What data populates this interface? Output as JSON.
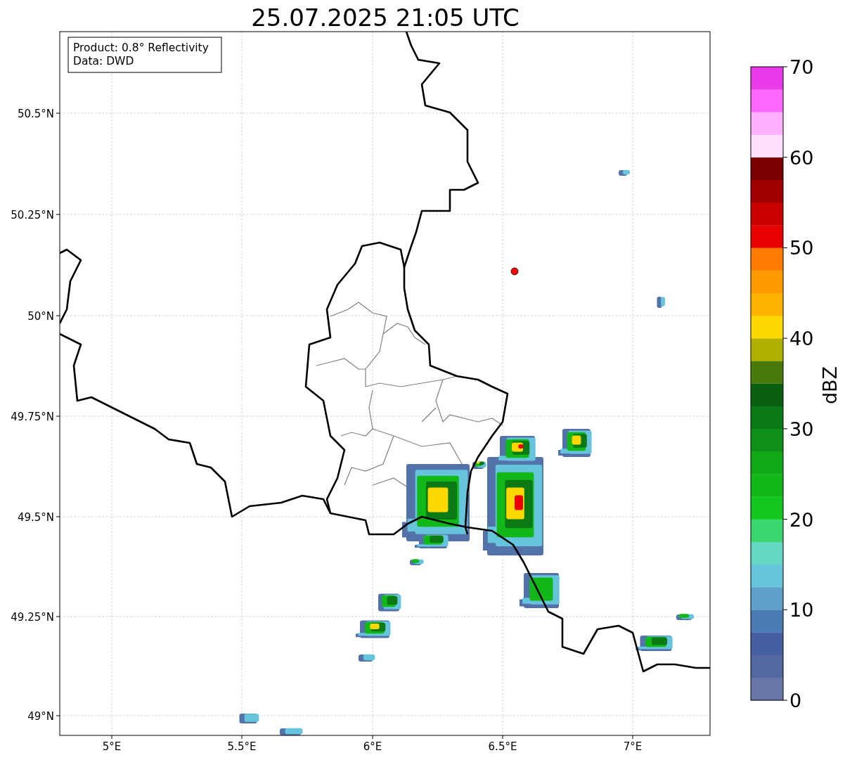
{
  "title": "25.07.2025 21:05 UTC",
  "map": {
    "info_lines": [
      "Product: 0.8° Reflectivity",
      "Data: DWD"
    ],
    "x_ticks": [
      "5°E",
      "5.5°E",
      "6°E",
      "6.5°E",
      "7°E"
    ],
    "y_ticks": [
      "50.5°N",
      "50.25°N",
      "50°N",
      "49.75°N",
      "49.5°N",
      "49.25°N",
      "49°N"
    ]
  },
  "colorbar": {
    "label": "dBZ",
    "ticks": [
      "70",
      "60",
      "50",
      "40",
      "30",
      "20",
      "10",
      "0"
    ],
    "segments": [
      {
        "color": "#6677a8"
      },
      {
        "color": "#5468a0"
      },
      {
        "color": "#465ea2"
      },
      {
        "color": "#4a7bb5"
      },
      {
        "color": "#5ea0c8"
      },
      {
        "color": "#66c4dc"
      },
      {
        "color": "#62d8c4"
      },
      {
        "color": "#3cd670"
      },
      {
        "color": "#12c820"
      },
      {
        "color": "#12b818"
      },
      {
        "color": "#10a814"
      },
      {
        "color": "#0e9018"
      },
      {
        "color": "#0c7a14"
      },
      {
        "color": "#086010"
      },
      {
        "color": "#4a7a0a"
      },
      {
        "color": "#b0b000"
      },
      {
        "color": "#ffd800"
      },
      {
        "color": "#ffb400"
      },
      {
        "color": "#ff9a00"
      },
      {
        "color": "#ff7c00"
      },
      {
        "color": "#e80000"
      },
      {
        "color": "#c80000"
      },
      {
        "color": "#a00000"
      },
      {
        "color": "#780000"
      },
      {
        "color": "#ffe0ff"
      },
      {
        "color": "#ffb0ff"
      },
      {
        "color": "#ff68ff"
      },
      {
        "color": "#e83ae8"
      }
    ]
  }
}
